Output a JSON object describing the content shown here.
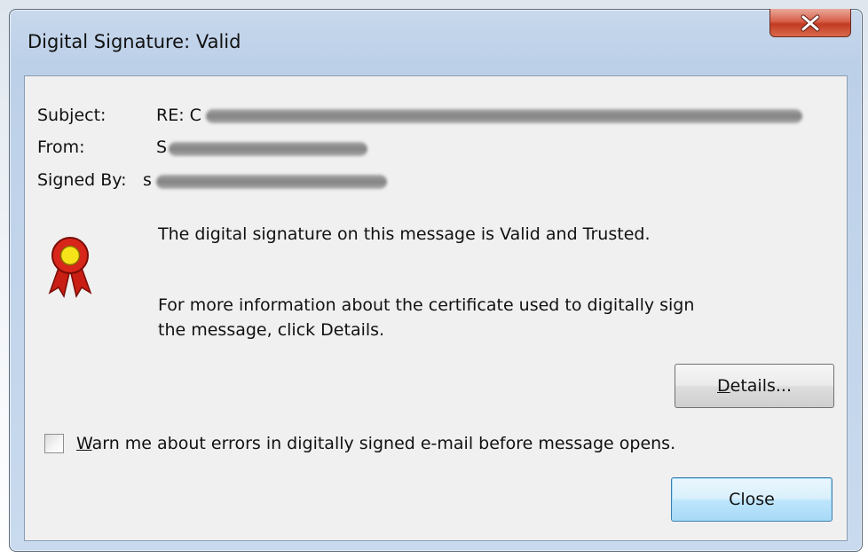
{
  "window": {
    "title": "Digital Signature: Valid",
    "close_glyph": "X"
  },
  "fields": {
    "subject_label": "Subject:",
    "subject_value": "RE: C",
    "from_label": "From:",
    "from_value": "S",
    "signed_by_label": "Signed By:",
    "signed_by_value": "s"
  },
  "icons": {
    "seal": "award-ribbon-icon",
    "close": "close-icon"
  },
  "messages": {
    "status": "The digital signature on this message is Valid and Trusted.",
    "info_line1": "For more information about the certificate used to digitally sign",
    "info_line2": "the message, click Details."
  },
  "buttons": {
    "details_label": "Details...",
    "close_label": "Close"
  },
  "options": {
    "warn_label": "Warn me about errors in digitally signed e-mail before message opens.",
    "warn_checked": false
  },
  "colors": {
    "seal_red": "#d8261b",
    "seal_yellow": "#f7e31a",
    "close_button_red": "#c23b22",
    "default_button_blue": "#3c7fb1"
  }
}
